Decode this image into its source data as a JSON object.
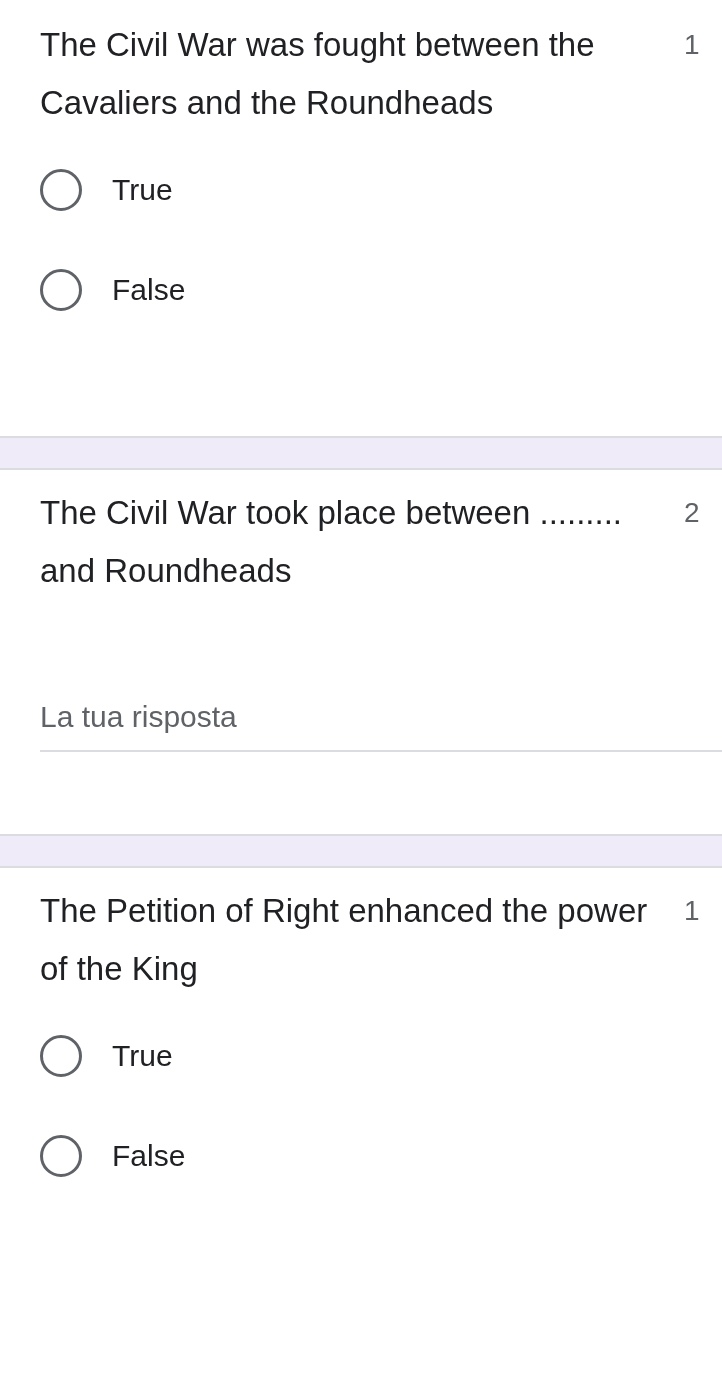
{
  "questions": [
    {
      "kind": "choice",
      "text": "The Civil War was fought between the Cavaliers and the Roundheads",
      "points": "1",
      "options": [
        {
          "label": "True",
          "selected": false
        },
        {
          "label": "False",
          "selected": false
        }
      ]
    },
    {
      "kind": "text",
      "text": "The Civil War took place between ......... and Roundheads",
      "points": "2",
      "answer": {
        "placeholder": "La tua risposta"
      }
    },
    {
      "kind": "choice",
      "text": "The Petition of Right enhanced the power of the King",
      "points": "1",
      "options": [
        {
          "label": "True",
          "selected": false
        },
        {
          "label": "False",
          "selected": false
        }
      ]
    }
  ]
}
